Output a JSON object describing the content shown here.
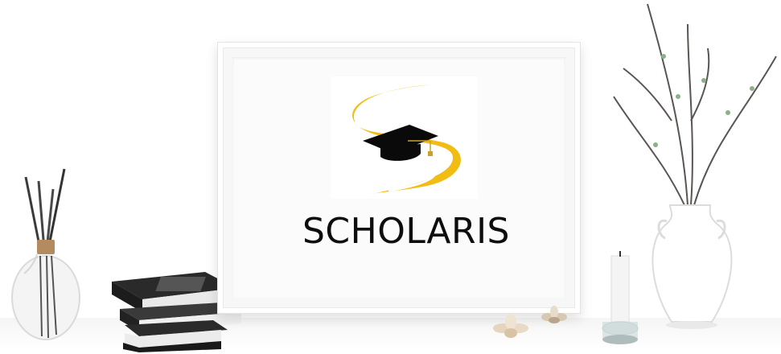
{
  "brand": {
    "name": "SCHOLARIS",
    "colors": {
      "logo_gold": "#f1bd13",
      "logo_black": "#0a0a0a",
      "text": "#0d0d0d"
    }
  },
  "decor": {
    "items": [
      "diffuser-bottle",
      "stacked-books",
      "picture-frame",
      "flower-ornaments",
      "candle-holder",
      "vase-with-branches"
    ]
  }
}
